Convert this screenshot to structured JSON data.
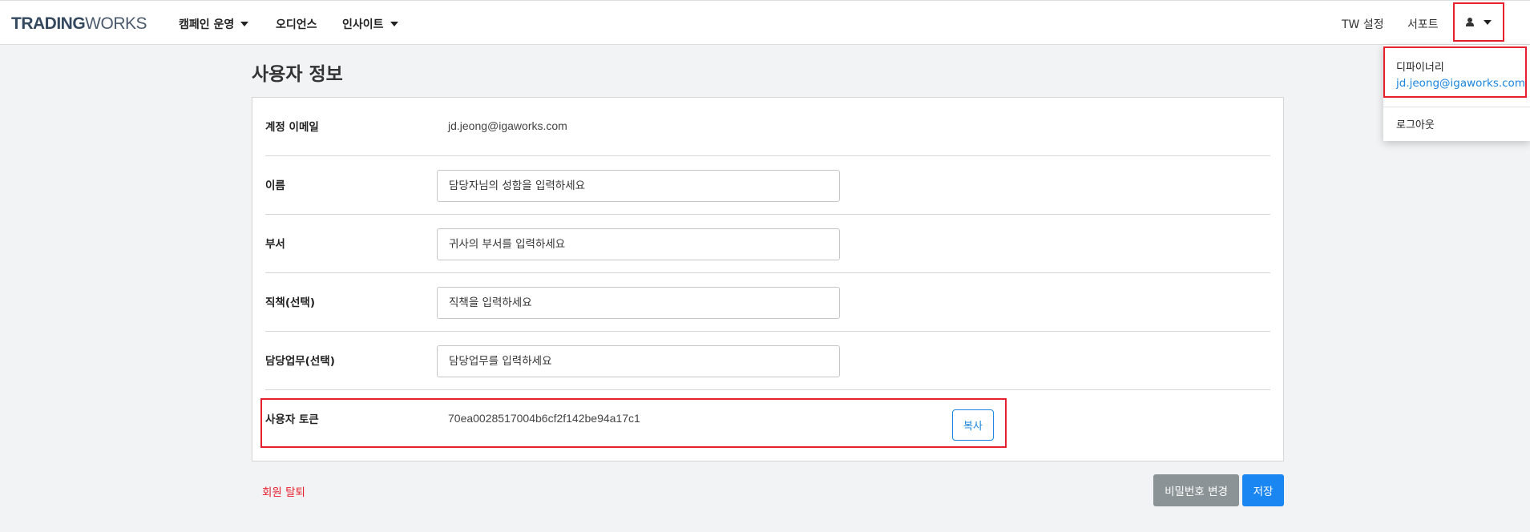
{
  "header": {
    "logo_bold": "TRADING",
    "logo_light": "WORKS",
    "nav": [
      {
        "label": "캠페인 운영",
        "has_dropdown": true
      },
      {
        "label": "오디언스",
        "has_dropdown": false
      },
      {
        "label": "인사이트",
        "has_dropdown": true
      }
    ],
    "right_links": [
      "TW 설정",
      "서포트"
    ],
    "user_menu_icon": "user-icon"
  },
  "user_dropdown": {
    "name": "디파이너리",
    "email": "jd.jeong@igaworks.com",
    "logout": "로그아웃"
  },
  "page": {
    "title": "사용자 정보",
    "rows": [
      {
        "label": "계정 이메일",
        "value": "jd.jeong@igaworks.com"
      },
      {
        "label": "이름",
        "placeholder": "담당자님의 성함을 입력하세요"
      },
      {
        "label": "부서",
        "placeholder": "귀사의 부서를 입력하세요"
      },
      {
        "label": "직책(선택)",
        "placeholder": "직책을 입력하세요"
      },
      {
        "label": "담당업무(선택)",
        "placeholder": "담당업무를 입력하세요"
      },
      {
        "label": "사용자 토큰",
        "value": "70ea0028517004b6cf2f142be94a17c1",
        "action": "복사"
      }
    ],
    "withdraw": "회원 탈퇴",
    "change_password": "비밀번호 변경",
    "save": "저장"
  },
  "colors": {
    "accent_blue": "#1a86f2",
    "highlight_red": "#e6202d",
    "gray_button": "#8c9396"
  }
}
